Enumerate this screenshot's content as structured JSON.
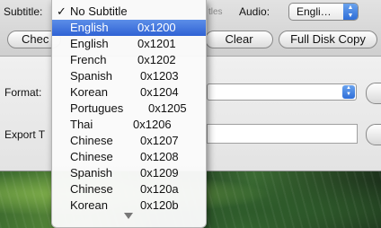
{
  "window": {
    "subtitle_label": "Subtitle:",
    "subtitle_extra": "tles",
    "audio_label": "Audio:",
    "audio_value": "Engli…",
    "check_button": "Chec",
    "clear_button": "Clear",
    "full_disk_copy_button": "Full Disk Copy",
    "format_label": "Format:",
    "export_label": "Export T"
  },
  "subtitle_menu": {
    "items": [
      {
        "check": "✓",
        "name": "No Subtitle",
        "code": ""
      },
      {
        "check": "",
        "name": "English",
        "code": "0x1200"
      },
      {
        "check": "",
        "name": "English",
        "code": "0x1201"
      },
      {
        "check": "",
        "name": "French",
        "code": "0x1202"
      },
      {
        "check": "",
        "name": "Spanish",
        "code": "0x1203"
      },
      {
        "check": "",
        "name": "Korean",
        "code": "0x1204"
      },
      {
        "check": "",
        "name": "Portugues",
        "code": "0x1205"
      },
      {
        "check": "",
        "name": "Thai",
        "code": "0x1206"
      },
      {
        "check": "",
        "name": "Chinese",
        "code": "0x1207"
      },
      {
        "check": "",
        "name": "Chinese",
        "code": "0x1208"
      },
      {
        "check": "",
        "name": "Spanish",
        "code": "0x1209"
      },
      {
        "check": "",
        "name": "Chinese",
        "code": "0x120a"
      },
      {
        "check": "",
        "name": "Korean",
        "code": "0x120b"
      }
    ],
    "highlighted_index": 1
  },
  "icons": [
    "check-mark-icon",
    "popup-arrows-icon",
    "scroll-down-icon"
  ]
}
